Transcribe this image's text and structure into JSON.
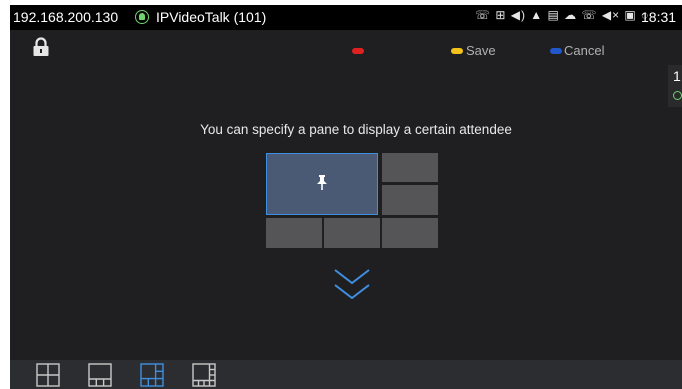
{
  "status_bar": {
    "ip": "192.168.200.130",
    "app_icon": "contact-circle-icon",
    "app_name": "IPVideoTalk (101)",
    "icons": "☏ ⊞ ◀) ▲ ▤ ☁ ☏ ◀× ▣ ◌",
    "time": "18:31"
  },
  "toolbar": {
    "lock_icon": "lock-icon",
    "red_key_label": "",
    "save_label": "Save",
    "cancel_label": "Cancel",
    "colors": {
      "red": "#e02121",
      "yellow": "#f3c21b",
      "blue": "#2157c9"
    }
  },
  "side_tab": {
    "number": "1",
    "icon": "status-icon"
  },
  "main": {
    "hint": "You can specify a pane to display a certain attendee",
    "selected_pane": "main",
    "pin_icon": "pin-icon",
    "next_icon": "double-chevron-down-icon",
    "accent_color": "#3f8fe0"
  },
  "bottom_bar": {
    "layouts": [
      {
        "name": "layout-2x2",
        "selected": false
      },
      {
        "name": "layout-1-plus-3",
        "selected": false
      },
      {
        "name": "layout-1-plus-5",
        "selected": true
      },
      {
        "name": "layout-1-plus-7",
        "selected": false
      }
    ]
  }
}
